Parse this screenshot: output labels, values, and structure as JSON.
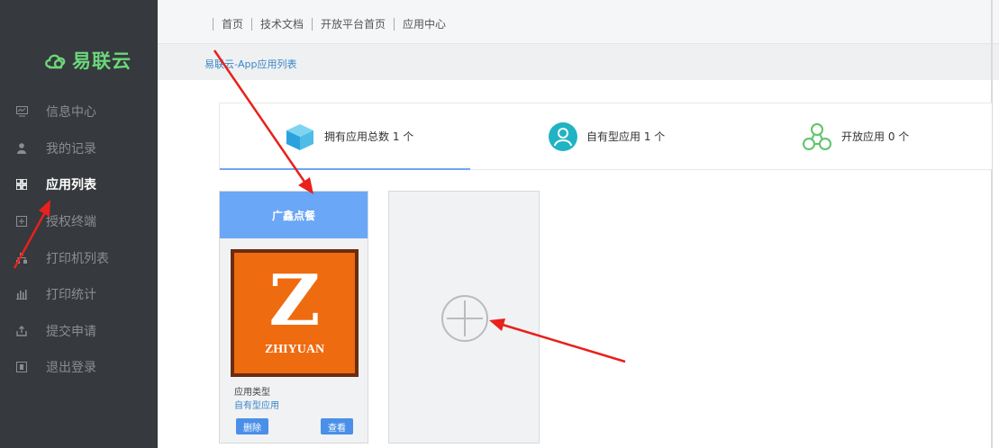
{
  "brand": {
    "name": "易联云"
  },
  "sidebar": {
    "items": [
      {
        "label": "信息中心",
        "icon": "monitor-icon",
        "active": false
      },
      {
        "label": "我的记录",
        "icon": "user-icon",
        "active": false
      },
      {
        "label": "应用列表",
        "icon": "grid-icon",
        "active": true
      },
      {
        "label": "授权终端",
        "icon": "plus-box-icon",
        "active": false
      },
      {
        "label": "打印机列表",
        "icon": "sitemap-icon",
        "active": false
      },
      {
        "label": "打印统计",
        "icon": "bar-chart-icon",
        "active": false
      },
      {
        "label": "提交申请",
        "icon": "upload-icon",
        "active": false
      },
      {
        "label": "退出登录",
        "icon": "exit-box-icon",
        "active": false
      }
    ]
  },
  "topnav": {
    "links": [
      "首页",
      "技术文档",
      "开放平台首页",
      "应用中心"
    ]
  },
  "breadcrumb": "易联云-App应用列表",
  "stats": [
    {
      "label": "拥有应用总数 1 个",
      "icon": "cube-icon"
    },
    {
      "label": "自有型应用 1 个",
      "icon": "user-circle-icon"
    },
    {
      "label": "开放应用 0 个",
      "icon": "network-icon"
    }
  ],
  "app_card": {
    "title": "广鑫点餐",
    "logo_letter": "Z",
    "logo_text": "ZHIYUAN",
    "type_label": "应用类型",
    "type_value": "自有型应用",
    "delete_label": "删除",
    "view_label": "查看"
  },
  "colors": {
    "sidebar_bg": "#36393d",
    "accent_blue": "#6aa7f6",
    "brand_green": "#6bd77a",
    "logo_orange": "#ef6b10",
    "annotation_red": "#e8211c"
  }
}
